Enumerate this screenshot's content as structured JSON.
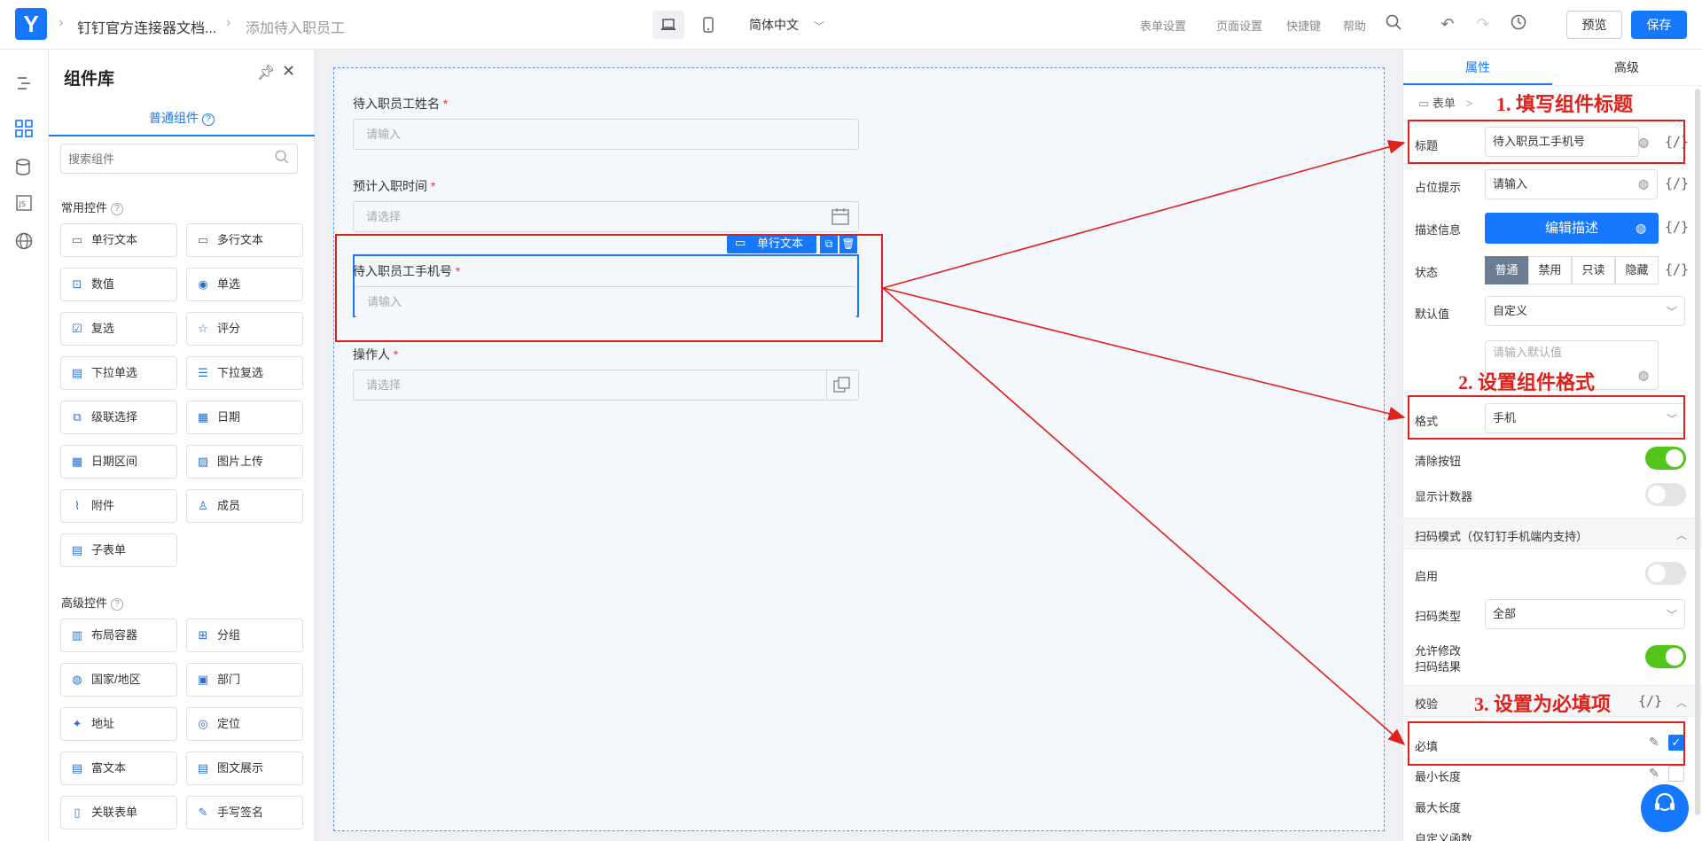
{
  "topbar": {
    "breadcrumb": [
      "钉钉官方连接器文档...",
      "添加待入职员工"
    ],
    "language": "简体中文",
    "links": [
      "表单设置",
      "页面设置",
      "快捷键",
      "帮助"
    ],
    "preview": "预览",
    "save": "保存"
  },
  "library": {
    "title": "组件库",
    "tab": "普通组件",
    "search_placeholder": "搜索组件",
    "common_title": "常用控件",
    "common": [
      "单行文本",
      "多行文本",
      "数值",
      "单选",
      "复选",
      "评分",
      "下拉单选",
      "下拉复选",
      "级联选择",
      "日期",
      "日期区间",
      "图片上传",
      "附件",
      "成员",
      "子表单"
    ],
    "advanced_title": "高级控件",
    "advanced": [
      "布局容器",
      "分组",
      "国家/地区",
      "部门",
      "地址",
      "定位",
      "富文本",
      "图文展示",
      "关联表单",
      "手写签名"
    ]
  },
  "form": {
    "fields": [
      {
        "label": "待入职员工姓名",
        "placeholder": "请输入"
      },
      {
        "label": "预计入职时间",
        "placeholder": "请选择"
      },
      {
        "label": "待入职员工手机号",
        "placeholder": "请输入"
      },
      {
        "label": "操作人",
        "placeholder": "请选择"
      }
    ],
    "required_mark": "*",
    "selected_tag": "单行文本"
  },
  "panel": {
    "tabs": [
      "属性",
      "高级"
    ],
    "crumb_root": "表单",
    "crumb_sep": ">",
    "title_label": "标题",
    "title_value": "待入职员工手机号",
    "placeholder_label": "占位提示",
    "placeholder_value": "请输入",
    "desc_label": "描述信息",
    "desc_button": "编辑描述",
    "state_label": "状态",
    "states": [
      "普通",
      "禁用",
      "只读",
      "隐藏"
    ],
    "default_label": "默认值",
    "default_value": "自定义",
    "default_placeholder": "请输入默认值",
    "format_label": "格式",
    "format_value": "手机",
    "clear_label": "清除按钮",
    "counter_label": "显示计数器",
    "scan_section": "扫码模式（仅钉钉手机端内支持）",
    "enable_label": "启用",
    "scan_type_label": "扫码类型",
    "scan_type_value": "全部",
    "allow_edit_label_1": "允许修改",
    "allow_edit_label_2": "扫码结果",
    "validate_section": "校验",
    "required_label": "必填",
    "min_label": "最小长度",
    "max_label": "最大长度",
    "custom_label": "自定义函数",
    "fx": "{/}"
  },
  "annotations": [
    "1. 填写组件标题",
    "2. 设置组件格式",
    "3. 设置为必填项"
  ],
  "colors": {
    "accent": "#1677ff",
    "annotation": "#e0201b",
    "toggle_on": "#52c41a"
  }
}
